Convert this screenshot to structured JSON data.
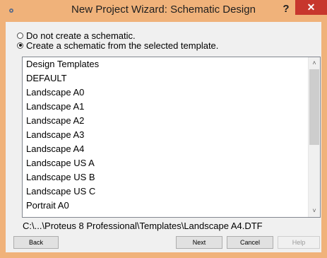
{
  "window": {
    "title": "New Project Wizard: Schematic Design",
    "help_glyph": "?",
    "close_glyph": "✕"
  },
  "options": {
    "no_schematic_label": "Do not create a schematic.",
    "from_template_label": "Create a schematic from the selected template.",
    "selected": "from_template"
  },
  "templates": {
    "header": "Design Templates",
    "items": [
      "DEFAULT",
      "Landscape A0",
      "Landscape A1",
      "Landscape A2",
      "Landscape A3",
      "Landscape A4",
      "Landscape US A",
      "Landscape US B",
      "Landscape US C",
      "Portrait A0"
    ]
  },
  "selected_path": "C:\\...\\Proteus 8 Professional\\Templates\\Landscape A4.DTF",
  "buttons": {
    "back": "Back",
    "next": "Next",
    "cancel": "Cancel",
    "help": "Help"
  },
  "scroll": {
    "up_glyph": "˄",
    "down_glyph": "˅"
  },
  "colors": {
    "titlebar": "#f0b27a",
    "close": "#c7372d"
  }
}
